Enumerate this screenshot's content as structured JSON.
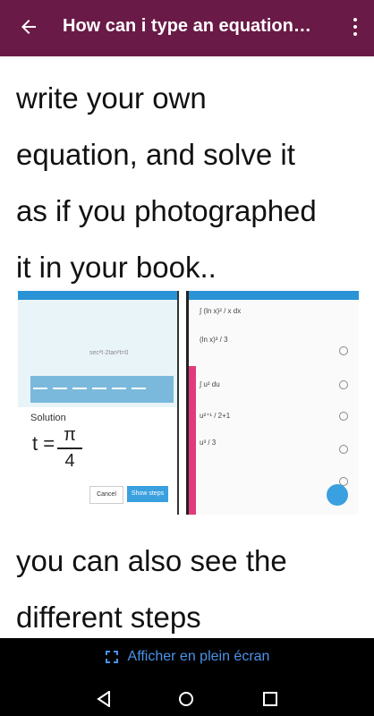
{
  "appbar": {
    "title": "How can i type an equation…"
  },
  "content": {
    "paragraph1": [
      "write your own",
      "equation, and solve it",
      "as if you photographed",
      "it in your book.."
    ],
    "paragraph2": [
      "you can also see the",
      "different steps"
    ]
  },
  "screenshot_left": {
    "solution_label": "Solution",
    "eq_lhs": "t =",
    "eq_num": "π",
    "eq_den": "4",
    "cancel_label": "Cancel",
    "show_steps_label": "Show steps"
  },
  "bottom": {
    "fullscreen_label": "Afficher en plein écran"
  },
  "colors": {
    "appbar": "#6a1a46",
    "link": "#4a94ea"
  }
}
